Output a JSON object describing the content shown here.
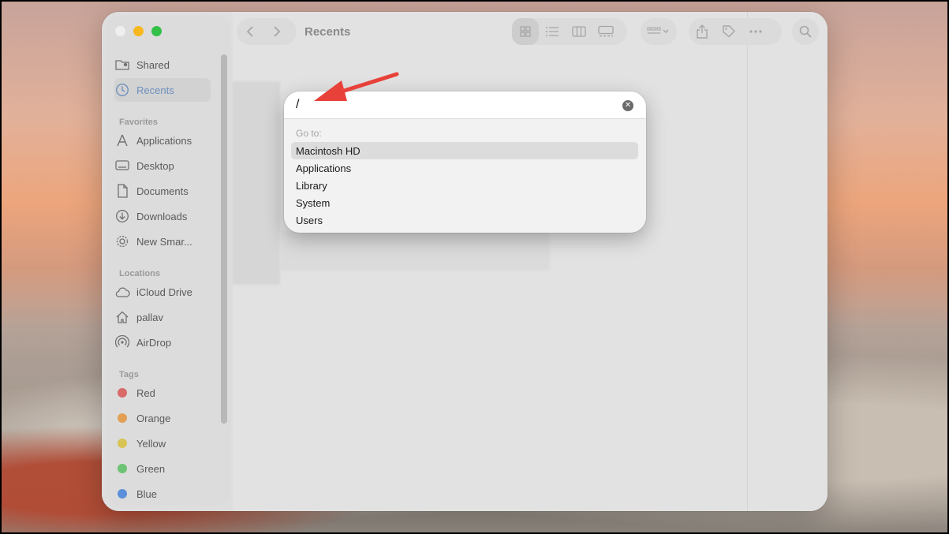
{
  "window": {
    "title": "Recents"
  },
  "sidebar": {
    "top_items": [
      {
        "label": "Shared",
        "icon": "shared-folder-icon"
      },
      {
        "label": "Recents",
        "icon": "clock-icon",
        "active": true
      }
    ],
    "favorites_header": "Favorites",
    "favorites": [
      {
        "label": "Applications",
        "icon": "applications-icon"
      },
      {
        "label": "Desktop",
        "icon": "desktop-icon"
      },
      {
        "label": "Documents",
        "icon": "document-icon"
      },
      {
        "label": "Downloads",
        "icon": "download-icon"
      },
      {
        "label": "New Smar...",
        "icon": "gear-icon"
      }
    ],
    "locations_header": "Locations",
    "locations": [
      {
        "label": "iCloud Drive",
        "icon": "cloud-icon"
      },
      {
        "label": "pallav",
        "icon": "home-icon"
      },
      {
        "label": "AirDrop",
        "icon": "airdrop-icon"
      }
    ],
    "tags_header": "Tags",
    "tags": [
      {
        "label": "Red",
        "color": "#d96a6a"
      },
      {
        "label": "Orange",
        "color": "#e3a055"
      },
      {
        "label": "Yellow",
        "color": "#d8c454"
      },
      {
        "label": "Green",
        "color": "#6cc474"
      },
      {
        "label": "Blue",
        "color": "#5b8fdb"
      }
    ]
  },
  "goto_dialog": {
    "input_value": "/",
    "section_label": "Go to:",
    "options": [
      {
        "label": "Macintosh HD",
        "selected": true
      },
      {
        "label": "Applications"
      },
      {
        "label": "Library"
      },
      {
        "label": "System"
      },
      {
        "label": "Users"
      }
    ]
  },
  "colors": {
    "accent": "#6e8fbf",
    "annotation_arrow": "#e8413a"
  }
}
